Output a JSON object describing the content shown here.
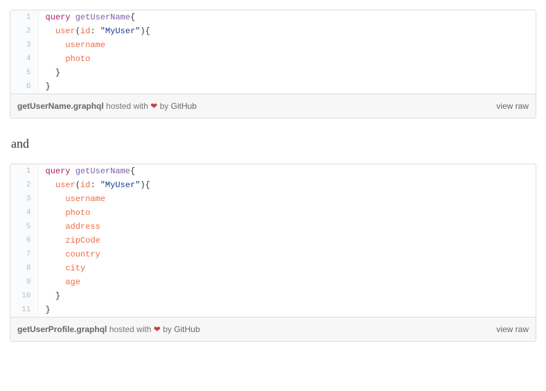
{
  "gists": [
    {
      "filename": "getUserName.graphql",
      "hosted_text": " hosted with ",
      "by_text": " by ",
      "github": "GitHub",
      "view_raw": "view raw",
      "lines": [
        [
          {
            "t": "keyword",
            "v": "query"
          },
          {
            "t": "plain",
            "v": " "
          },
          {
            "t": "entity",
            "v": "getUserName"
          },
          {
            "t": "plain",
            "v": "{"
          }
        ],
        [
          {
            "t": "plain",
            "v": "  "
          },
          {
            "t": "attr",
            "v": "user"
          },
          {
            "t": "plain",
            "v": "("
          },
          {
            "t": "attr",
            "v": "id"
          },
          {
            "t": "plain",
            "v": ": "
          },
          {
            "t": "string",
            "v": "\"MyUser\""
          },
          {
            "t": "plain",
            "v": "){"
          }
        ],
        [
          {
            "t": "plain",
            "v": "    "
          },
          {
            "t": "attr",
            "v": "username"
          }
        ],
        [
          {
            "t": "plain",
            "v": "    "
          },
          {
            "t": "attr",
            "v": "photo"
          }
        ],
        [
          {
            "t": "plain",
            "v": "  }"
          }
        ],
        [
          {
            "t": "plain",
            "v": "}"
          }
        ]
      ]
    },
    {
      "filename": "getUserProfile.graphql",
      "hosted_text": " hosted with ",
      "by_text": " by ",
      "github": "GitHub",
      "view_raw": "view raw",
      "lines": [
        [
          {
            "t": "keyword",
            "v": "query"
          },
          {
            "t": "plain",
            "v": " "
          },
          {
            "t": "entity",
            "v": "getUserName"
          },
          {
            "t": "plain",
            "v": "{"
          }
        ],
        [
          {
            "t": "plain",
            "v": "  "
          },
          {
            "t": "attr",
            "v": "user"
          },
          {
            "t": "plain",
            "v": "("
          },
          {
            "t": "attr",
            "v": "id"
          },
          {
            "t": "plain",
            "v": ": "
          },
          {
            "t": "string",
            "v": "\"MyUser\""
          },
          {
            "t": "plain",
            "v": "){"
          }
        ],
        [
          {
            "t": "plain",
            "v": "    "
          },
          {
            "t": "attr",
            "v": "username"
          }
        ],
        [
          {
            "t": "plain",
            "v": "    "
          },
          {
            "t": "attr",
            "v": "photo"
          }
        ],
        [
          {
            "t": "plain",
            "v": "    "
          },
          {
            "t": "attr",
            "v": "address"
          }
        ],
        [
          {
            "t": "plain",
            "v": "    "
          },
          {
            "t": "attr",
            "v": "zipCode"
          }
        ],
        [
          {
            "t": "plain",
            "v": "    "
          },
          {
            "t": "attr",
            "v": "country"
          }
        ],
        [
          {
            "t": "plain",
            "v": "    "
          },
          {
            "t": "attr",
            "v": "city"
          }
        ],
        [
          {
            "t": "plain",
            "v": "    "
          },
          {
            "t": "attr",
            "v": "age"
          }
        ],
        [
          {
            "t": "plain",
            "v": "  }"
          }
        ],
        [
          {
            "t": "plain",
            "v": "}"
          }
        ]
      ]
    }
  ],
  "between": "and",
  "heart": "❤"
}
